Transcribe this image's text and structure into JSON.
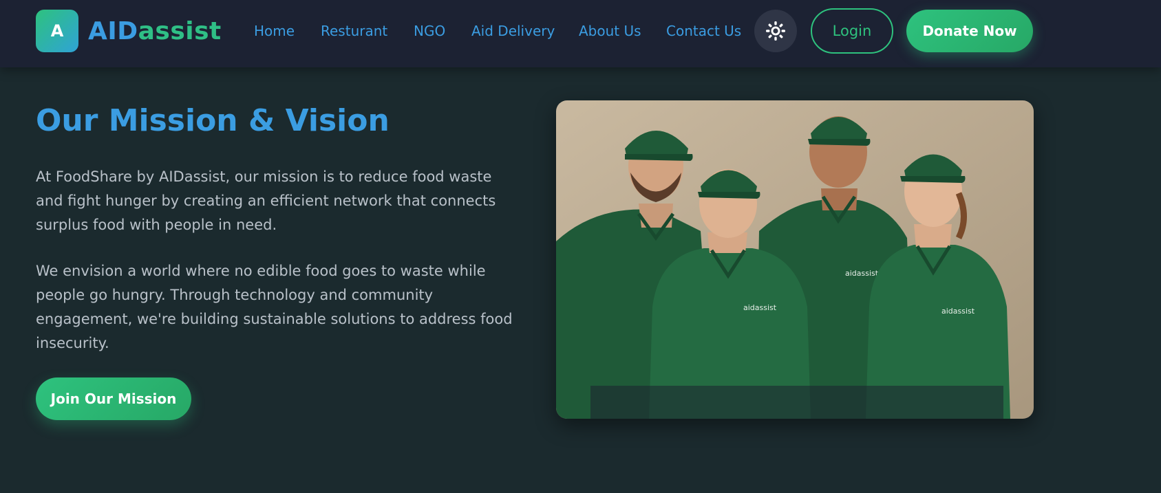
{
  "brand": {
    "logo_letter": "A",
    "name_part1": "AID",
    "name_part2": "assist"
  },
  "nav": {
    "items": [
      {
        "label": "Home"
      },
      {
        "label": "Resturant"
      },
      {
        "label": "NGO"
      },
      {
        "label": "Aid Delivery"
      },
      {
        "label": "About Us"
      },
      {
        "label": "Contact Us"
      }
    ],
    "theme_icon": "sun-icon",
    "login_label": "Login",
    "donate_label": "Donate Now"
  },
  "mission": {
    "title": "Our Mission & Vision",
    "paragraph1": "At FoodShare by AIDassist, our mission is to reduce food waste and fight hunger by creating an efficient network that connects surplus food with people in need.",
    "paragraph2": "We envision a world where no edible food goes to waste while people go hungry. Through technology and community engagement, we're building sustainable solutions to address food insecurity.",
    "cta_label": "Join Our Mission",
    "shirt_logo_text": "aidassist"
  },
  "colors": {
    "accent_blue": "#3b9de2",
    "accent_green": "#2ec27e",
    "header_bg": "#1c2233",
    "page_bg": "#1b2a2e",
    "body_text": "#b9c1c9"
  }
}
